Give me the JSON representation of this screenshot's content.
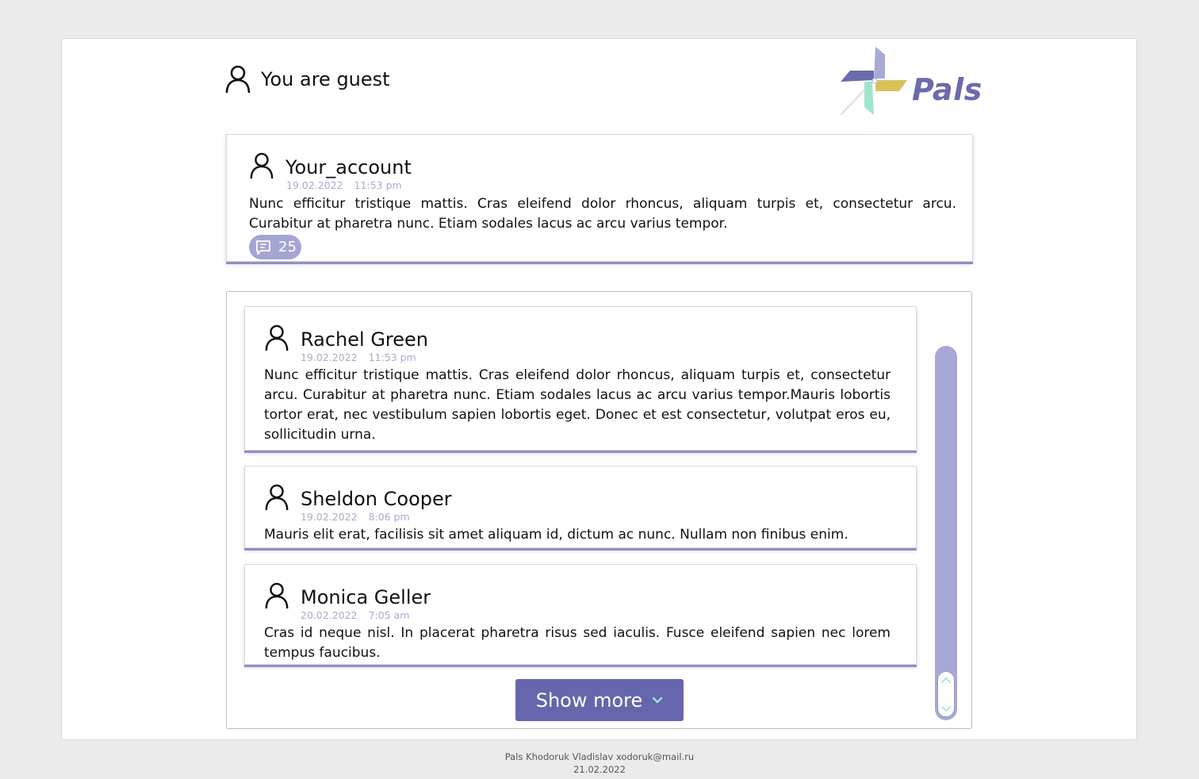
{
  "header": {
    "guest_text": "You are guest",
    "logo_text": "Pals"
  },
  "post": {
    "author": "Your_account",
    "date": "19.02.2022",
    "time": "11:53 pm",
    "text": "Nunc efficitur tristique mattis. Cras eleifend dolor rhoncus, aliquam turpis et, consectetur arcu. Curabitur at pharetra nunc. Etiam sodales lacus ac arcu varius tempor.",
    "comment_count": "25"
  },
  "comments": [
    {
      "author": "Rachel Green",
      "date": "19.02.2022",
      "time": "11:53 pm",
      "text": "Nunc efficitur tristique mattis. Cras eleifend dolor rhoncus, aliquam turpis et, consectetur arcu. Curabitur at pharetra nunc. Etiam sodales lacus ac arcu varius tempor.Mauris lobortis tortor erat, nec vestibulum sapien lobortis eget. Donec et est consectetur, volutpat eros eu, sollicitudin urna."
    },
    {
      "author": "Sheldon Cooper",
      "date": "19.02.2022",
      "time": "8:06 pm",
      "text": "Mauris elit erat, facilisis sit amet aliquam id, dictum ac nunc. Nullam non finibus enim."
    },
    {
      "author": "Monica Geller",
      "date": "20.02.2022",
      "time": "7:05 am",
      "text": "Cras id neque nisl. In placerat pharetra risus sed iaculis. Fusce eleifend sapien nec lorem tempus faucibus."
    }
  ],
  "show_more_label": "Show more",
  "footer": {
    "line1": "Pals Khodoruk Vladislav xodoruk@mail.ru",
    "line2": "21.02.2022"
  },
  "colors": {
    "accent": "#6666ad",
    "accent_light": "#a8a8d4",
    "meta_text": "#a9a9d0",
    "logo_yellow": "#d9c15a",
    "logo_mint": "#9fe6cf",
    "background": "#ebebeb"
  },
  "icons": {
    "user": "user-icon",
    "comment": "comment-icon",
    "chevron": "chevron-down-icon",
    "scroll_up": "chevron-up-icon",
    "scroll_down": "chevron-down-icon",
    "logo": "pinwheel-logo"
  }
}
